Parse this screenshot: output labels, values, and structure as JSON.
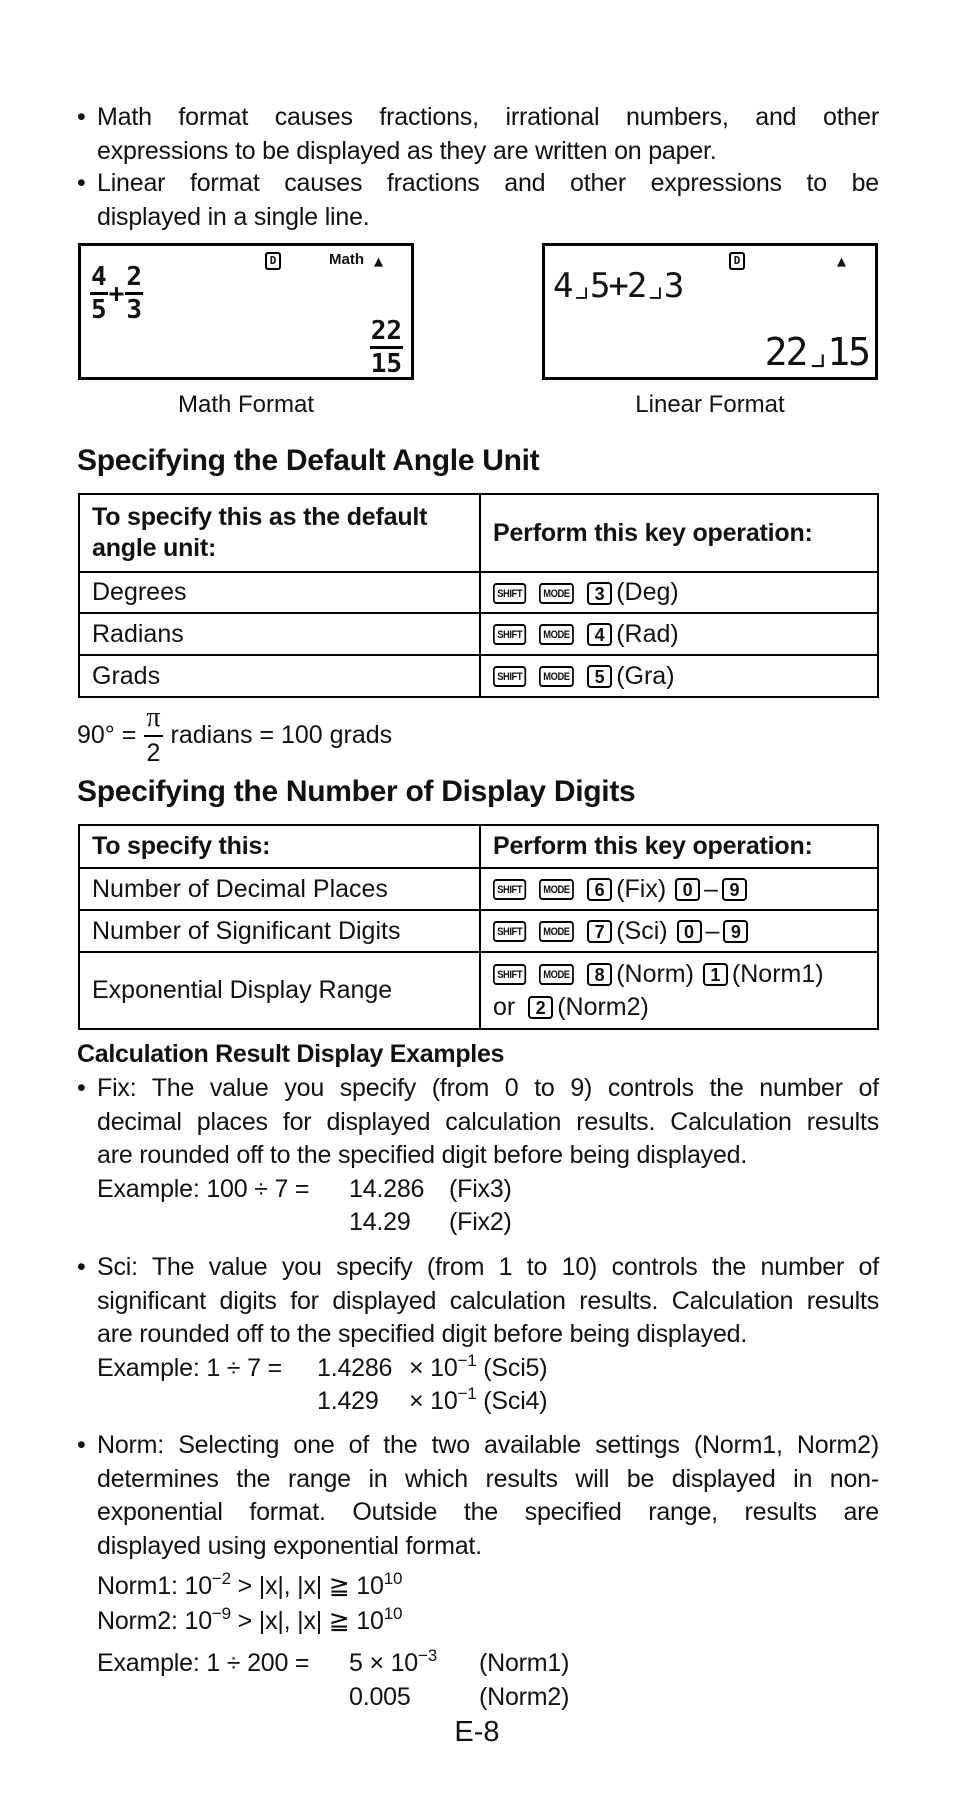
{
  "intro_bullets": [
    {
      "lines": [
        "Math format causes fractions, irrational numbers, and other",
        "expressions to be displayed as they are written on paper."
      ]
    },
    {
      "lines": [
        "Linear format causes fractions and other expressions to be",
        "displayed in a single line."
      ]
    }
  ],
  "screens": {
    "math": {
      "indicator_d": "D",
      "indicator_mode": "Math",
      "indicator_arrow": "▲",
      "expr": {
        "a_num": "4",
        "a_den": "5",
        "op": "+",
        "b_num": "2",
        "b_den": "3"
      },
      "result": {
        "num": "22",
        "den": "15"
      },
      "caption": "Math Format"
    },
    "linear": {
      "indicator_d": "D",
      "indicator_arrow": "▲",
      "expr": "4⌟5+2⌟3",
      "result": "22⌟15",
      "caption": "Linear Format"
    }
  },
  "angle_section": {
    "title": "Specifying the Default Angle Unit",
    "headers": [
      "To specify this as the default angle unit:",
      "Perform this key operation:"
    ],
    "rows": [
      {
        "label": "Degrees",
        "keys": [
          "SHIFT",
          "MODE",
          "3"
        ],
        "suffix": "(Deg)"
      },
      {
        "label": "Radians",
        "keys": [
          "SHIFT",
          "MODE",
          "4"
        ],
        "suffix": "(Rad)"
      },
      {
        "label": "Grads",
        "keys": [
          "SHIFT",
          "MODE",
          "5"
        ],
        "suffix": "(Gra)"
      }
    ],
    "formula": {
      "left": "90° =",
      "pi": "π",
      "den": "2",
      "right": "radians = 100 grads"
    }
  },
  "digits_section": {
    "title": "Specifying the Number of Display Digits",
    "headers": [
      "To specify this:",
      "Perform this key operation:"
    ],
    "rows": [
      {
        "label": "Number of Decimal Places",
        "keys": [
          "SHIFT",
          "MODE",
          "6"
        ],
        "suffix": "(Fix)",
        "range": [
          "0",
          "9"
        ]
      },
      {
        "label": "Number of Significant Digits",
        "keys": [
          "SHIFT",
          "MODE",
          "7"
        ],
        "suffix": "(Sci)",
        "range": [
          "0",
          "9"
        ]
      },
      {
        "label": "Exponential Display Range",
        "keys": [
          "SHIFT",
          "MODE",
          "8"
        ],
        "suffix": "(Norm)",
        "key2": "1",
        "suffix2": "(Norm1)",
        "or": "or",
        "key3": "2",
        "suffix3": "(Norm2)"
      }
    ],
    "range_dash": "–"
  },
  "examples": {
    "title": "Calculation Result Display Examples",
    "fix": {
      "lines": [
        "Fix: The value you specify (from 0 to 9) controls the number of",
        "decimal places for displayed calculation results. Calculation results",
        "are rounded off to the specified digit before being displayed."
      ],
      "example_label": "Example: 100 ÷ 7 =",
      "results": [
        {
          "value": "14.286",
          "mode": "(Fix3)"
        },
        {
          "value": "14.29",
          "mode": "(Fix2)"
        }
      ]
    },
    "sci": {
      "lines": [
        "Sci: The value you specify (from 1 to 10) controls the number of",
        "significant digits for displayed calculation results. Calculation results",
        "are rounded off to the specified digit before being displayed."
      ],
      "example_label": "Example: 1 ÷ 7 =",
      "results": [
        {
          "mantissa": "1.4286",
          "times": "× 10",
          "exp": "−1",
          "mode": "(Sci5)"
        },
        {
          "mantissa": "1.429",
          "times": "× 10",
          "exp": "−1",
          "mode": "(Sci4)"
        }
      ]
    },
    "norm": {
      "lines": [
        "Norm: Selecting one of the two available settings (Norm1, Norm2)",
        "determines the range in which results will be displayed in non-",
        "exponential format. Outside the specified range, results are",
        "displayed using exponential format."
      ],
      "ranges": [
        {
          "label": "Norm1: 10",
          "low_exp": "−2",
          "mid": " > |x|, |x| ≧ 10",
          "high_exp": "10"
        },
        {
          "label": "Norm2: 10",
          "low_exp": "−9",
          "mid": " > |x|, |x| ≧ 10",
          "high_exp": "10"
        }
      ],
      "example_label": "Example: 1 ÷ 200 =",
      "results": [
        {
          "value": "5 × 10",
          "exp": "−3",
          "mode": "(Norm1)"
        },
        {
          "value": "0.005",
          "exp": "",
          "mode": "(Norm2)"
        }
      ]
    }
  },
  "page_number": "E-8"
}
